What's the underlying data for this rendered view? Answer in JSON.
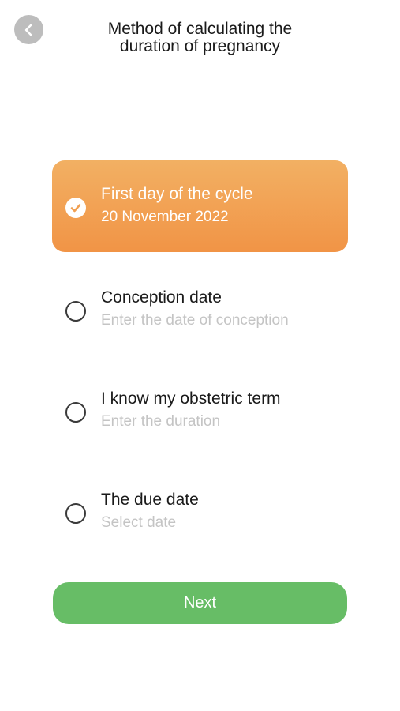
{
  "header": {
    "back_icon": "chevron-left-icon",
    "title": "Method of calculating the\nduration of pregnancy"
  },
  "options": [
    {
      "title": "First day of the cycle",
      "subtitle": "20 November 2022",
      "selected": true
    },
    {
      "title": "Conception date",
      "subtitle": "Enter the date of conception",
      "selected": false
    },
    {
      "title": "I know my obstetric term",
      "subtitle": "Enter the duration",
      "selected": false
    },
    {
      "title": "The due date",
      "subtitle": "Select date",
      "selected": false
    }
  ],
  "next_button": {
    "label": "Next"
  },
  "colors": {
    "selected_gradient_top": "#f2b063",
    "selected_gradient_bottom": "#f19446",
    "next_button": "#67bd66",
    "back_button": "#bdbdbd",
    "placeholder_text": "#c4c4c4"
  }
}
